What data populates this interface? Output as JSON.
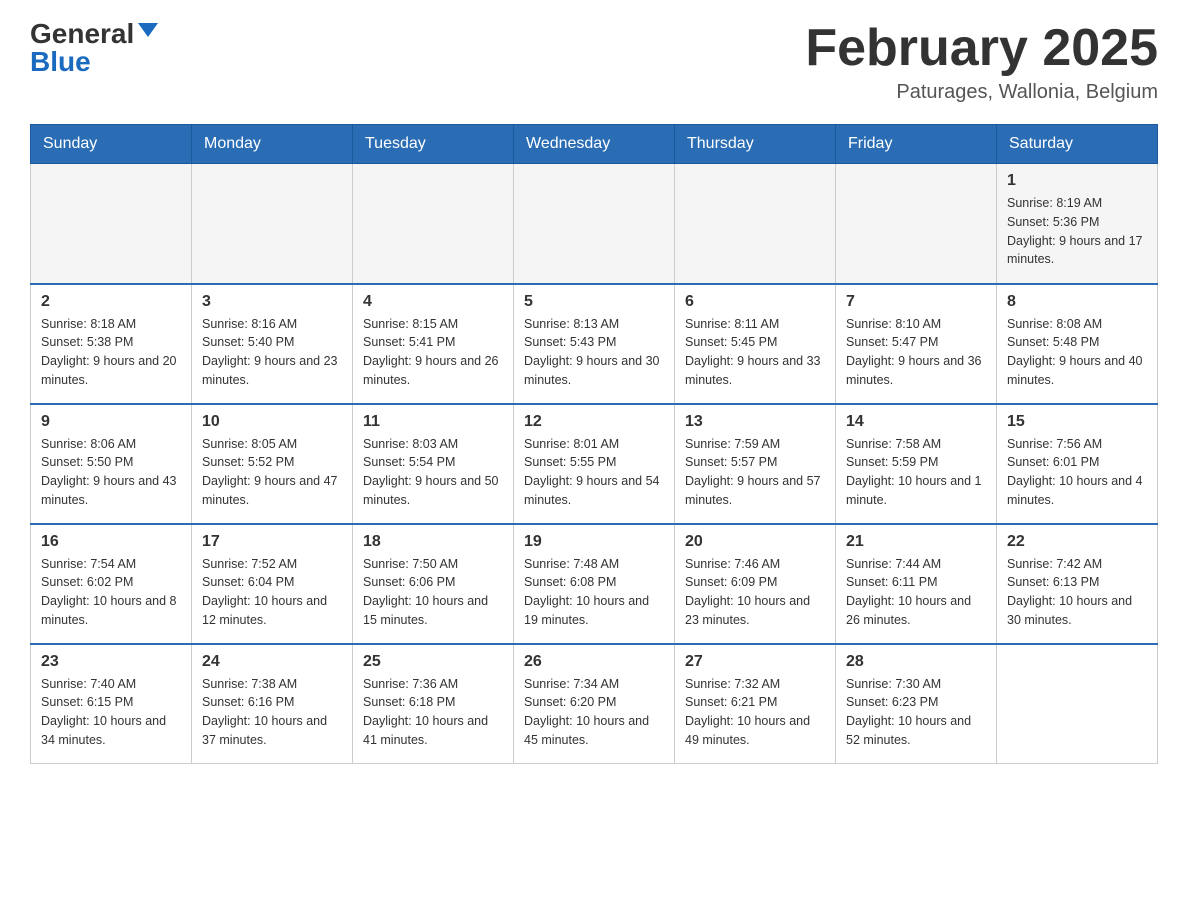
{
  "logo": {
    "general": "General",
    "blue": "Blue"
  },
  "header": {
    "title": "February 2025",
    "subtitle": "Paturages, Wallonia, Belgium"
  },
  "weekdays": [
    "Sunday",
    "Monday",
    "Tuesday",
    "Wednesday",
    "Thursday",
    "Friday",
    "Saturday"
  ],
  "weeks": [
    {
      "days": [
        {
          "date": "",
          "info": ""
        },
        {
          "date": "",
          "info": ""
        },
        {
          "date": "",
          "info": ""
        },
        {
          "date": "",
          "info": ""
        },
        {
          "date": "",
          "info": ""
        },
        {
          "date": "",
          "info": ""
        },
        {
          "date": "1",
          "info": "Sunrise: 8:19 AM\nSunset: 5:36 PM\nDaylight: 9 hours and 17 minutes."
        }
      ]
    },
    {
      "days": [
        {
          "date": "2",
          "info": "Sunrise: 8:18 AM\nSunset: 5:38 PM\nDaylight: 9 hours and 20 minutes."
        },
        {
          "date": "3",
          "info": "Sunrise: 8:16 AM\nSunset: 5:40 PM\nDaylight: 9 hours and 23 minutes."
        },
        {
          "date": "4",
          "info": "Sunrise: 8:15 AM\nSunset: 5:41 PM\nDaylight: 9 hours and 26 minutes."
        },
        {
          "date": "5",
          "info": "Sunrise: 8:13 AM\nSunset: 5:43 PM\nDaylight: 9 hours and 30 minutes."
        },
        {
          "date": "6",
          "info": "Sunrise: 8:11 AM\nSunset: 5:45 PM\nDaylight: 9 hours and 33 minutes."
        },
        {
          "date": "7",
          "info": "Sunrise: 8:10 AM\nSunset: 5:47 PM\nDaylight: 9 hours and 36 minutes."
        },
        {
          "date": "8",
          "info": "Sunrise: 8:08 AM\nSunset: 5:48 PM\nDaylight: 9 hours and 40 minutes."
        }
      ]
    },
    {
      "days": [
        {
          "date": "9",
          "info": "Sunrise: 8:06 AM\nSunset: 5:50 PM\nDaylight: 9 hours and 43 minutes."
        },
        {
          "date": "10",
          "info": "Sunrise: 8:05 AM\nSunset: 5:52 PM\nDaylight: 9 hours and 47 minutes."
        },
        {
          "date": "11",
          "info": "Sunrise: 8:03 AM\nSunset: 5:54 PM\nDaylight: 9 hours and 50 minutes."
        },
        {
          "date": "12",
          "info": "Sunrise: 8:01 AM\nSunset: 5:55 PM\nDaylight: 9 hours and 54 minutes."
        },
        {
          "date": "13",
          "info": "Sunrise: 7:59 AM\nSunset: 5:57 PM\nDaylight: 9 hours and 57 minutes."
        },
        {
          "date": "14",
          "info": "Sunrise: 7:58 AM\nSunset: 5:59 PM\nDaylight: 10 hours and 1 minute."
        },
        {
          "date": "15",
          "info": "Sunrise: 7:56 AM\nSunset: 6:01 PM\nDaylight: 10 hours and 4 minutes."
        }
      ]
    },
    {
      "days": [
        {
          "date": "16",
          "info": "Sunrise: 7:54 AM\nSunset: 6:02 PM\nDaylight: 10 hours and 8 minutes."
        },
        {
          "date": "17",
          "info": "Sunrise: 7:52 AM\nSunset: 6:04 PM\nDaylight: 10 hours and 12 minutes."
        },
        {
          "date": "18",
          "info": "Sunrise: 7:50 AM\nSunset: 6:06 PM\nDaylight: 10 hours and 15 minutes."
        },
        {
          "date": "19",
          "info": "Sunrise: 7:48 AM\nSunset: 6:08 PM\nDaylight: 10 hours and 19 minutes."
        },
        {
          "date": "20",
          "info": "Sunrise: 7:46 AM\nSunset: 6:09 PM\nDaylight: 10 hours and 23 minutes."
        },
        {
          "date": "21",
          "info": "Sunrise: 7:44 AM\nSunset: 6:11 PM\nDaylight: 10 hours and 26 minutes."
        },
        {
          "date": "22",
          "info": "Sunrise: 7:42 AM\nSunset: 6:13 PM\nDaylight: 10 hours and 30 minutes."
        }
      ]
    },
    {
      "days": [
        {
          "date": "23",
          "info": "Sunrise: 7:40 AM\nSunset: 6:15 PM\nDaylight: 10 hours and 34 minutes."
        },
        {
          "date": "24",
          "info": "Sunrise: 7:38 AM\nSunset: 6:16 PM\nDaylight: 10 hours and 37 minutes."
        },
        {
          "date": "25",
          "info": "Sunrise: 7:36 AM\nSunset: 6:18 PM\nDaylight: 10 hours and 41 minutes."
        },
        {
          "date": "26",
          "info": "Sunrise: 7:34 AM\nSunset: 6:20 PM\nDaylight: 10 hours and 45 minutes."
        },
        {
          "date": "27",
          "info": "Sunrise: 7:32 AM\nSunset: 6:21 PM\nDaylight: 10 hours and 49 minutes."
        },
        {
          "date": "28",
          "info": "Sunrise: 7:30 AM\nSunset: 6:23 PM\nDaylight: 10 hours and 52 minutes."
        },
        {
          "date": "",
          "info": ""
        }
      ]
    }
  ]
}
